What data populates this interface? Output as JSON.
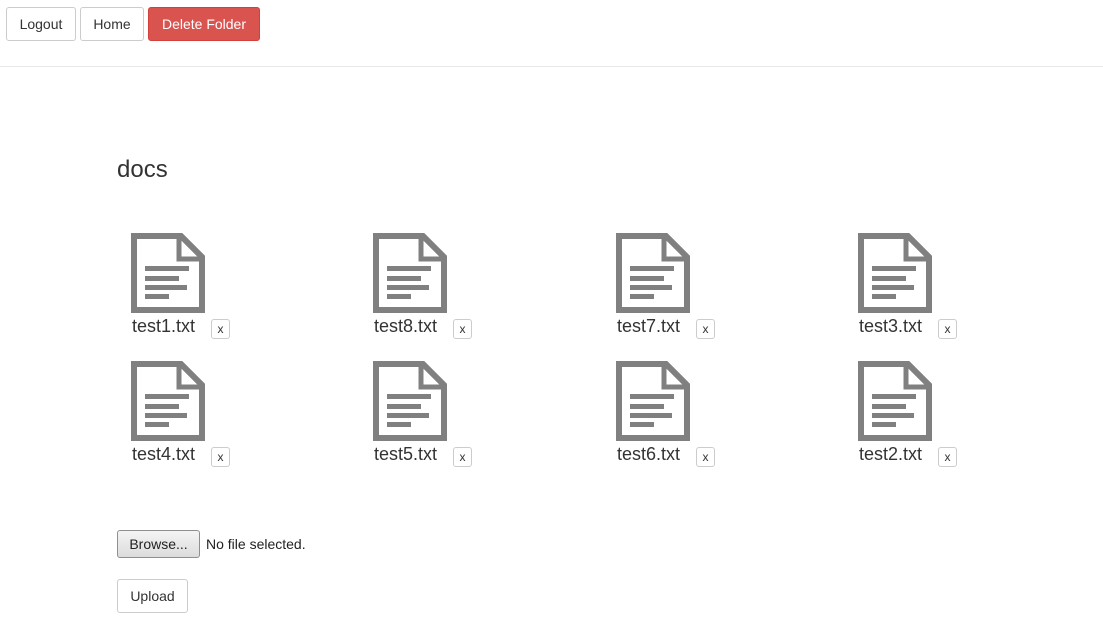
{
  "toolbar": {
    "logout_label": "Logout",
    "home_label": "Home",
    "delete_folder_label": "Delete Folder",
    "danger_color": "#d9534f"
  },
  "folder": {
    "title": "docs"
  },
  "files": [
    {
      "name": "test1.txt",
      "delete_label": "x",
      "icon": "document-icon"
    },
    {
      "name": "test8.txt",
      "delete_label": "x",
      "icon": "document-icon"
    },
    {
      "name": "test7.txt",
      "delete_label": "x",
      "icon": "document-icon"
    },
    {
      "name": "test3.txt",
      "delete_label": "x",
      "icon": "document-icon"
    },
    {
      "name": "test4.txt",
      "delete_label": "x",
      "icon": "document-icon"
    },
    {
      "name": "test5.txt",
      "delete_label": "x",
      "icon": "document-icon"
    },
    {
      "name": "test6.txt",
      "delete_label": "x",
      "icon": "document-icon"
    },
    {
      "name": "test2.txt",
      "delete_label": "x",
      "icon": "document-icon"
    }
  ],
  "upload": {
    "browse_label": "Browse...",
    "status_text": "No file selected.",
    "upload_label": "Upload"
  }
}
